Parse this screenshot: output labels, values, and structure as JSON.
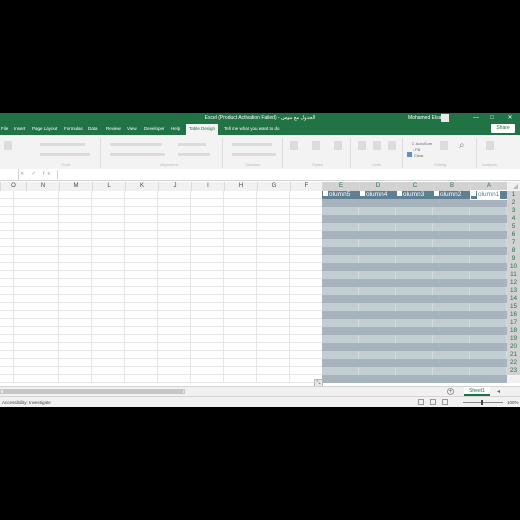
{
  "window": {
    "title": "Excel (Product Activation Failed) - الجدول مع موس",
    "user": "Mohamed Elsaidi",
    "min": "—",
    "max": "□",
    "close": "✕"
  },
  "tabs": [
    {
      "label": "File",
      "active": false
    },
    {
      "label": "Insert",
      "active": false
    },
    {
      "label": "Page Layout",
      "active": false
    },
    {
      "label": "Formulas",
      "active": false
    },
    {
      "label": "Data",
      "active": false
    },
    {
      "label": "Review",
      "active": false
    },
    {
      "label": "View",
      "active": false
    },
    {
      "label": "Developer",
      "active": false
    },
    {
      "label": "Help",
      "active": false
    },
    {
      "label": "Table Design",
      "active": true
    }
  ],
  "tell_me": "Tell me what you want to do",
  "share": "Share",
  "ribbon": {
    "groups": [
      "Font",
      "Alignment",
      "Number",
      "Styles",
      "Cells",
      "Editing",
      "Analysis"
    ],
    "editing_items": [
      "AutoSum",
      "Fill",
      "Clear"
    ]
  },
  "formula_bar": {
    "icons": "✕ ✓ fx"
  },
  "columns": [
    "O",
    "N",
    "M",
    "L",
    "K",
    "J",
    "I",
    "H",
    "G",
    "F",
    "E",
    "D",
    "C",
    "B",
    "A"
  ],
  "selected_columns": [
    "E",
    "D",
    "C",
    "B",
    "A"
  ],
  "table": {
    "headers": [
      "Column5",
      "Column4",
      "Column3",
      "Column2",
      "Column1"
    ],
    "header_display": [
      "olumn5",
      "olumn4",
      "olumn3",
      "olumn2",
      "olumn1"
    ],
    "active_header": "Column1"
  },
  "rows": [
    "1",
    "2",
    "3",
    "4",
    "5",
    "6",
    "7",
    "8",
    "9",
    "10",
    "11",
    "12",
    "13",
    "14",
    "15",
    "16",
    "17",
    "18",
    "19",
    "20",
    "21",
    "22",
    "23"
  ],
  "sheet_tabs": [
    {
      "label": "Sheet1",
      "active": true
    }
  ],
  "status": {
    "accessibility": "Accessibility: Investigate",
    "zoom": "100%"
  },
  "colors": {
    "excel_green": "#217346",
    "table_header": "#5f7f93",
    "table_band": "#a7b3bd",
    "table_fill": "#c3cdd4"
  }
}
